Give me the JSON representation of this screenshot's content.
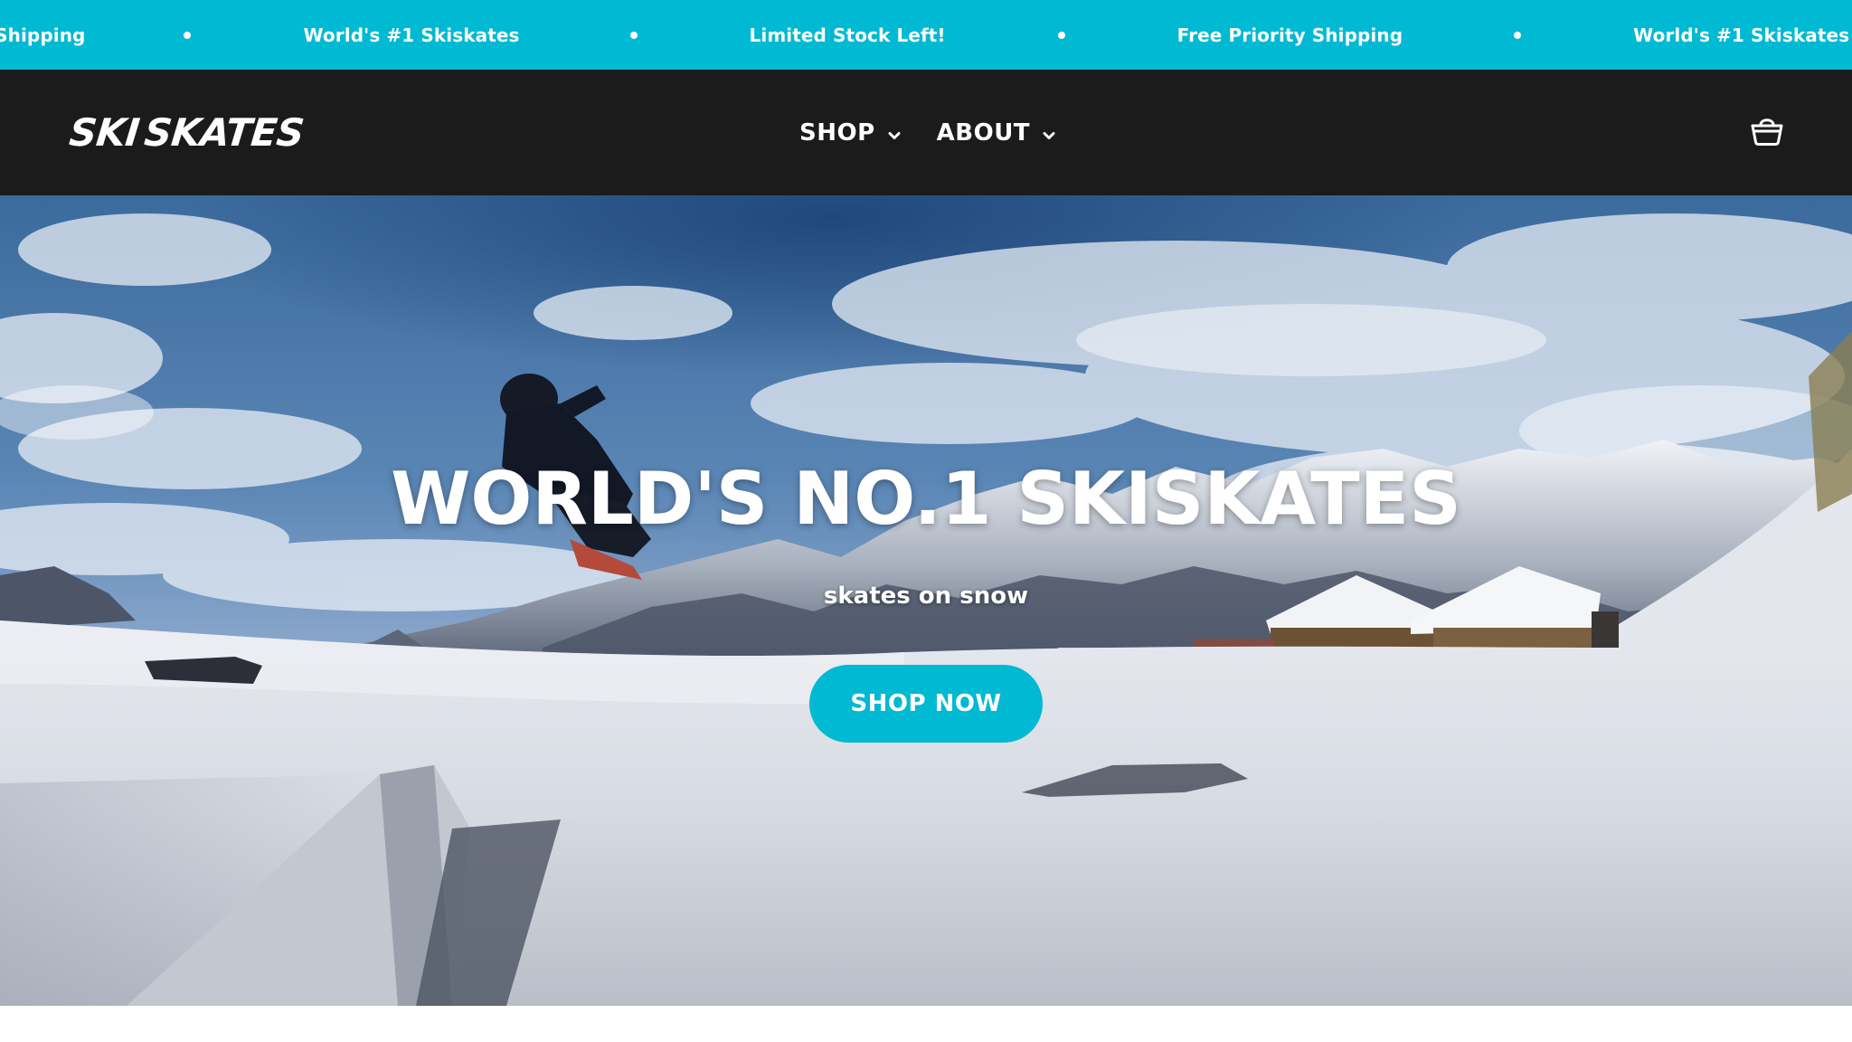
{
  "announcement": {
    "background": "#00b9d3",
    "items": [
      "Free Priority Shipping",
      "World's #1 Skiskates",
      "Limited Stock Left!",
      "Free Priority Shipping",
      "World's #1 Skiskates"
    ]
  },
  "header": {
    "logo_part1": "SKI",
    "logo_part2": "SKATES",
    "nav": [
      {
        "label": "SHOP",
        "icon": "chevron-down-icon"
      },
      {
        "label": "ABOUT",
        "icon": "chevron-down-icon"
      }
    ],
    "cart_icon": "basket-icon"
  },
  "hero": {
    "title": "WORLD'S NO.1 SKISKATES",
    "subtitle": "skates on snow",
    "cta_label": "SHOP NOW",
    "accent": "#00b9d3"
  }
}
